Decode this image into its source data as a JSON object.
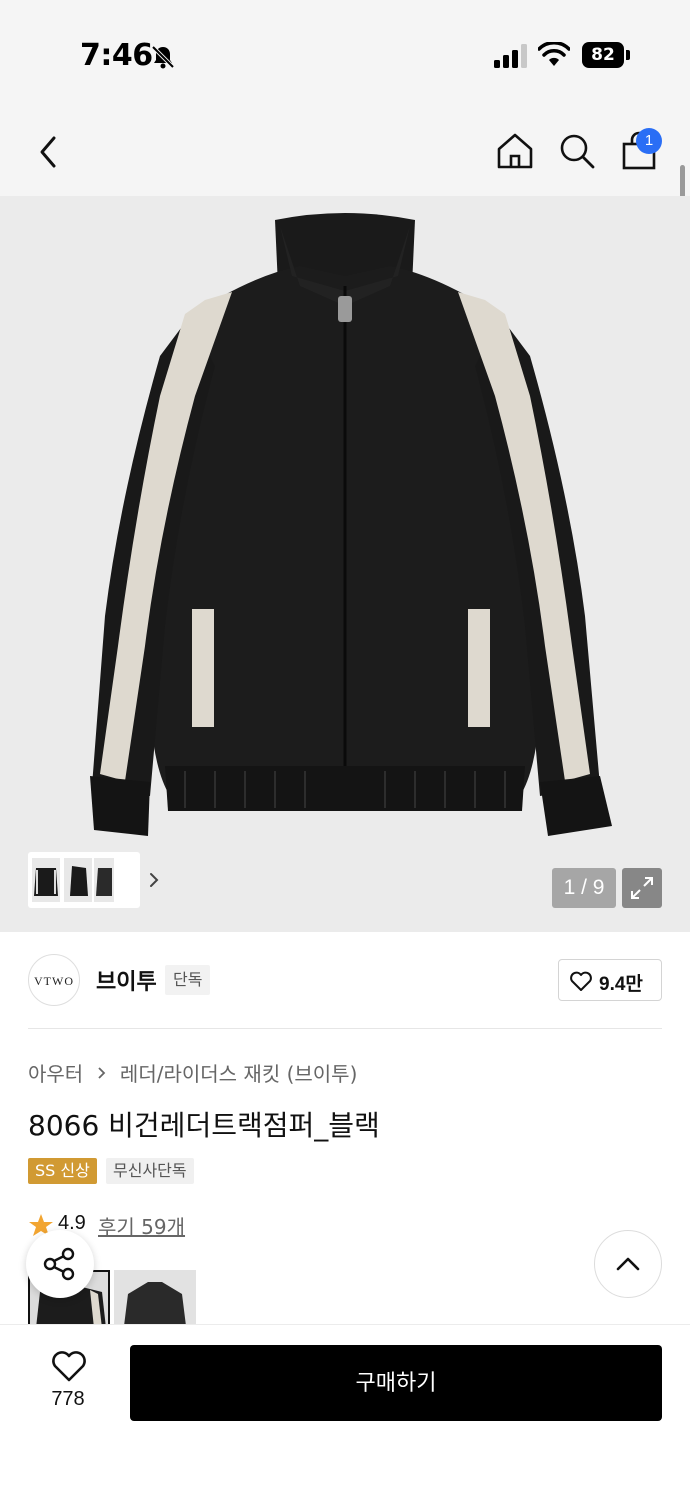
{
  "status_bar": {
    "time": "7:46",
    "battery": "82",
    "icons": [
      "bell-slash-icon",
      "signal-icon",
      "wifi-icon",
      "battery-icon"
    ]
  },
  "nav": {
    "icons": [
      "back-chevron-icon",
      "home-icon",
      "search-icon",
      "shopping-bag-icon"
    ],
    "cart_badge": "1"
  },
  "gallery": {
    "page_indicator": "1 / 9",
    "current_page": 1,
    "total_pages": 9,
    "icons": [
      "chevron-right-icon",
      "expand-icon"
    ]
  },
  "brand": {
    "logo_text": "VTWO",
    "name": "브이투",
    "tag": "단독",
    "likes": "9.4만"
  },
  "breadcrumb": {
    "category": "아우터",
    "subcategory": "레더/라이더스 재킷 (브이투)"
  },
  "product": {
    "title": "8066 비건레더트랙점퍼_블랙",
    "tags": [
      "SS 신상",
      "무신사단독"
    ],
    "rating": "4.9",
    "reviews_link": "후기 59개"
  },
  "bottom_bar": {
    "favorite_count": "778",
    "buy_label": "구매하기"
  },
  "colors": {
    "accent_badge": "#2a6ef5",
    "new_tag": "#d19a33",
    "star": "#f2a531",
    "buy_button": "#000000"
  }
}
